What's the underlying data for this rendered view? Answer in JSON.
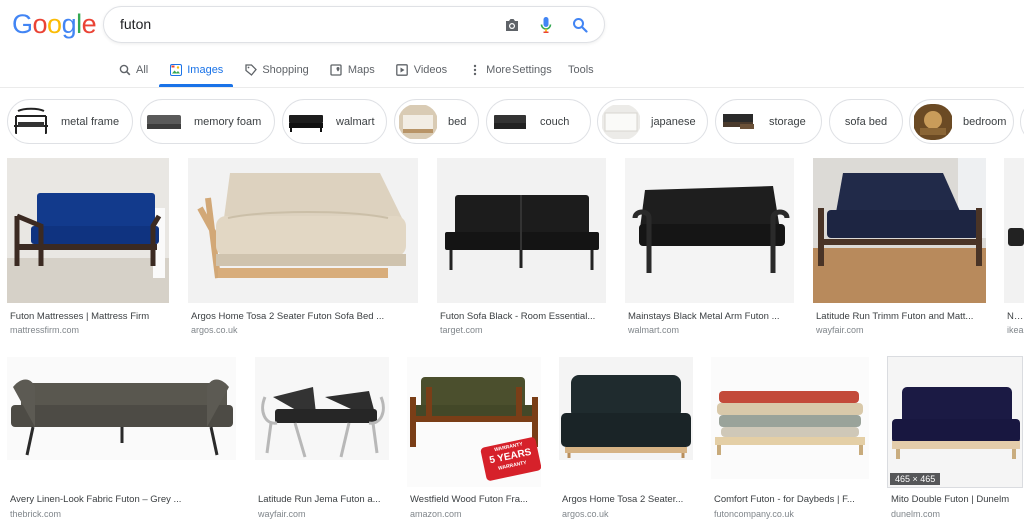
{
  "logo": {
    "letters": [
      "G",
      "o",
      "o",
      "g",
      "l",
      "e"
    ],
    "colors": [
      "#4285F4",
      "#EA4335",
      "#FBBC05",
      "#4285F4",
      "#34A853",
      "#EA4335"
    ]
  },
  "search": {
    "query": "futon",
    "icons": [
      "camera-icon",
      "microphone-icon",
      "search-icon"
    ]
  },
  "nav": {
    "tabs": [
      {
        "label": "All",
        "icon": "search-icon"
      },
      {
        "label": "Images",
        "icon": "image-icon",
        "active": true
      },
      {
        "label": "Shopping",
        "icon": "tag-icon"
      },
      {
        "label": "Maps",
        "icon": "map-icon"
      },
      {
        "label": "Videos",
        "icon": "play-icon"
      },
      {
        "label": "More",
        "icon": "more-icon"
      }
    ],
    "settings": "Settings",
    "tools": "Tools",
    "accent": "#1a73e8"
  },
  "chips": [
    {
      "label": "metal frame"
    },
    {
      "label": "memory foam"
    },
    {
      "label": "walmart"
    },
    {
      "label": "bed"
    },
    {
      "label": "couch"
    },
    {
      "label": "japanese"
    },
    {
      "label": "storage"
    },
    {
      "label": "sofa bed"
    },
    {
      "label": "bedroom"
    }
  ],
  "results": [
    {
      "title": "Futon Mattresses | Mattress Firm",
      "source": "mattressfirm.com"
    },
    {
      "title": "Argos Home Tosa 2 Seater Futon Sofa Bed ...",
      "source": "argos.co.uk"
    },
    {
      "title": "Futon Sofa Black - Room Essential...",
      "source": "target.com"
    },
    {
      "title": "Mainstays Black Metal Arm Futon ...",
      "source": "walmart.com"
    },
    {
      "title": "Latitude Run Trimm Futon and Matt...",
      "source": "wayfair.com"
    },
    {
      "title": "NYK...",
      "source": "ikea..."
    },
    {
      "title": "Avery Linen-Look Fabric Futon – Grey ...",
      "source": "thebrick.com"
    },
    {
      "title": "Latitude Run Jema Futon a...",
      "source": "wayfair.com"
    },
    {
      "title": "Westfield Wood Futon Fra...",
      "source": "amazon.com"
    },
    {
      "title": "Argos Home Tosa 2 Seater...",
      "source": "argos.co.uk"
    },
    {
      "title": "Comfort Futon - for Daybeds | F...",
      "source": "futoncompany.co.uk"
    },
    {
      "title": "Mito Double Futon | Dunelm",
      "source": "dunelm.com",
      "badge": "465 × 465"
    }
  ],
  "warranty": {
    "top": "WARRANTY",
    "main": "5 YEARS",
    "bottom": "WARRANTY"
  }
}
